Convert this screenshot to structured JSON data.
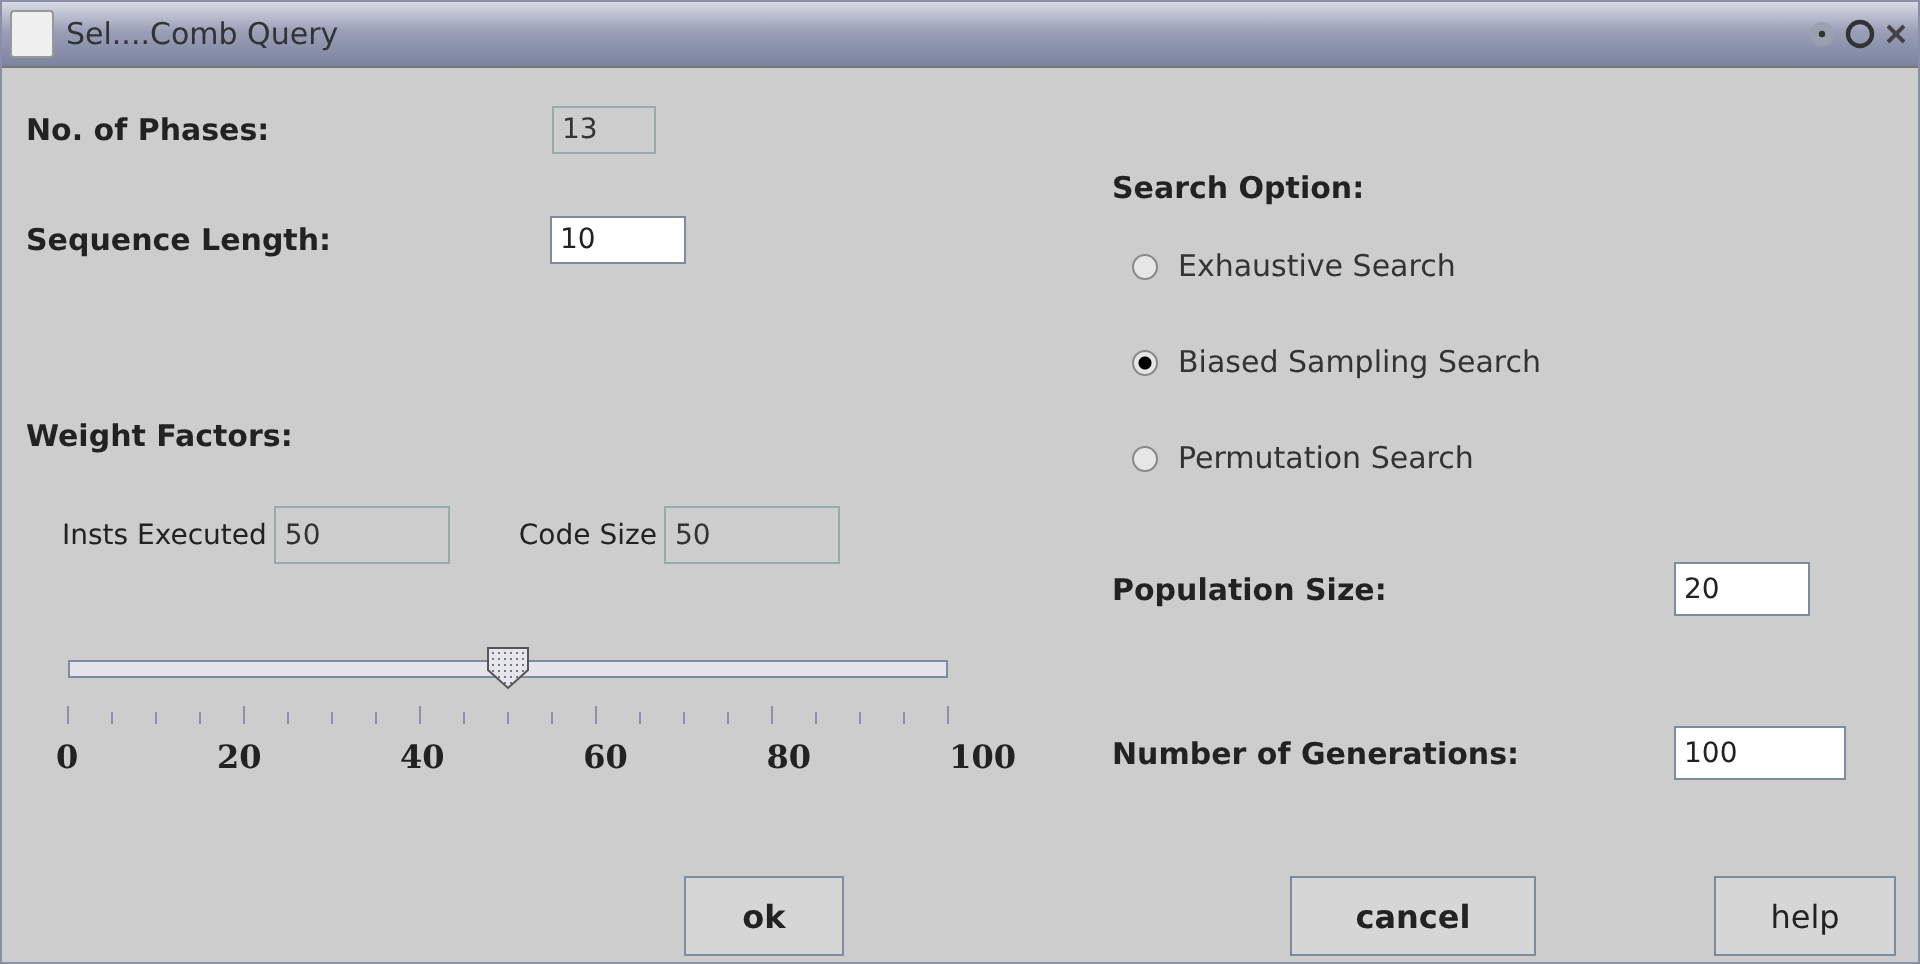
{
  "window": {
    "title": "Sel....Comb Query"
  },
  "fields": [
    {
      "label": "No. of Phases:",
      "value": "13",
      "disabled": true
    },
    {
      "label": "Sequence Length:",
      "value": "10",
      "disabled": false
    }
  ],
  "weight_factors": {
    "title": "Weight Factors:",
    "fields": [
      {
        "label": "Insts Executed",
        "value": "50",
        "disabled": true
      },
      {
        "label": "Code Size",
        "value": "50",
        "disabled": true
      }
    ],
    "slider": {
      "level": 0.5,
      "labels": [
        "0",
        "20",
        "40",
        "60",
        "80",
        "100"
      ]
    }
  },
  "search_option": {
    "title": "Search Option:",
    "options": [
      {
        "label": "Exhaustive Search",
        "selected": false
      },
      {
        "label": "Biased Sampling Search",
        "selected": true
      },
      {
        "label": "Permutation Search",
        "selected": false
      }
    ]
  },
  "right_fields": [
    {
      "label": "Population Size:",
      "value": "20",
      "disabled": false
    },
    {
      "label": "Number of Generations:",
      "value": "100",
      "disabled": false
    }
  ],
  "buttons": [
    "ok",
    "cancel",
    "help"
  ]
}
